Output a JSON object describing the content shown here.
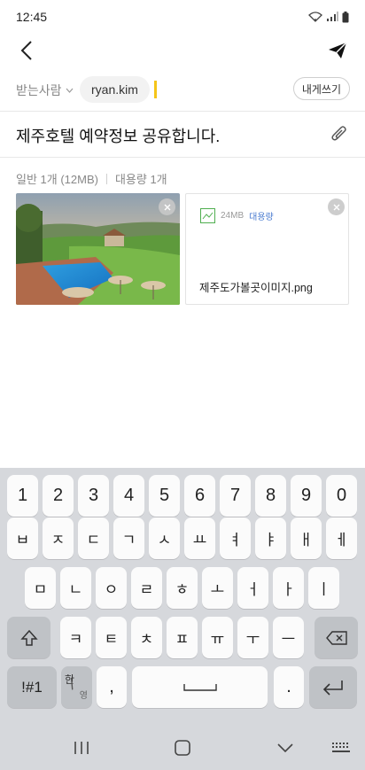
{
  "status": {
    "time": "12:45"
  },
  "header": {
    "back_icon": "chevron-left-icon",
    "send_icon": "paper-plane-icon"
  },
  "recipients": {
    "label": "받는사람",
    "chips": [
      "ryan.kim"
    ],
    "self_button": "내게쓰기"
  },
  "subject": {
    "text": "제주호텔 예약정보 공유합니다."
  },
  "attachments": {
    "normal_summary": "일반 1개 (12MB)",
    "large_summary": "대용량 1개",
    "items": [
      {
        "type": "image",
        "description_icon": "photo-thumbnail"
      },
      {
        "type": "file",
        "size": "24MB",
        "tag": "대용량",
        "name": "제주도가볼곳이미지.png"
      }
    ]
  },
  "keyboard": {
    "row1": [
      "1",
      "2",
      "3",
      "4",
      "5",
      "6",
      "7",
      "8",
      "9",
      "0"
    ],
    "row2": [
      "ㅂ",
      "ㅈ",
      "ㄷ",
      "ㄱ",
      "ㅅ",
      "ㅛ",
      "ㅕ",
      "ㅑ",
      "ㅐ",
      "ㅔ"
    ],
    "row3": [
      "ㅁ",
      "ㄴ",
      "ㅇ",
      "ㄹ",
      "ㅎ",
      "ㅗ",
      "ㅓ",
      "ㅏ",
      "ㅣ"
    ],
    "row4": [
      "ㅋ",
      "ㅌ",
      "ㅊ",
      "ㅍ",
      "ㅠ",
      "ㅜ",
      "ㅡ"
    ],
    "sym_key": "!#1",
    "lang_top": "한",
    "lang_bottom": "영",
    "comma": ",",
    "period": "."
  }
}
